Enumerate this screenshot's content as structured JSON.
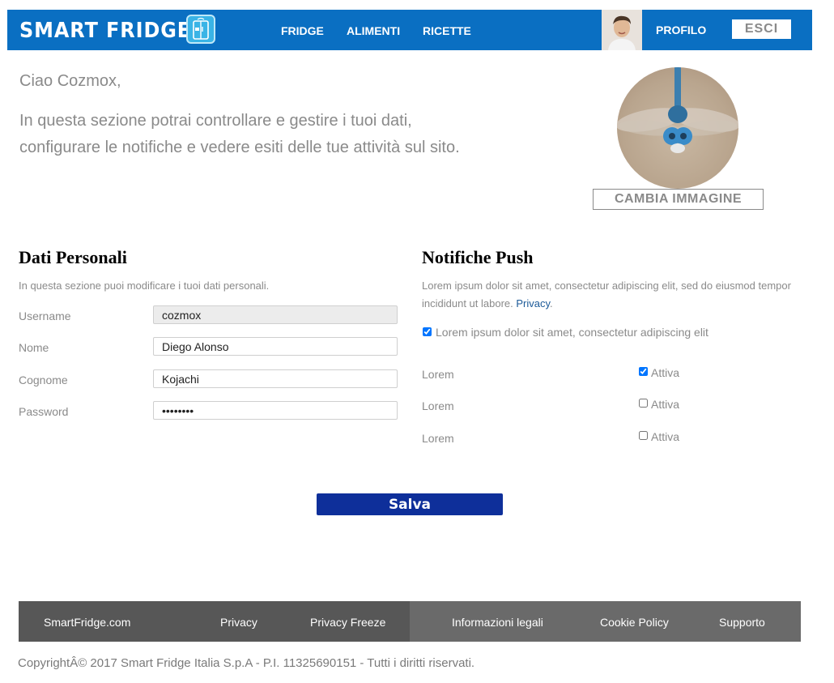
{
  "header": {
    "brand": "SMART FRIDGE",
    "nav": [
      "FRIDGE",
      "ALIMENTI",
      "RICETTE"
    ],
    "profile_link": "PROFILO",
    "logout_label": "ESCI"
  },
  "intro": {
    "greeting": "Ciao Cozmox,",
    "line1": "In questa sezione potrai controllare e gestire i tuoi dati,",
    "line2": "configurare le notifiche e vedere esiti delle tue attività sul sito.",
    "change_image_label": "CAMBIA IMMAGINE"
  },
  "personal": {
    "title": "Dati Personali",
    "description": "In questa sezione puoi modificare i tuoi dati personali.",
    "fields": [
      {
        "label": "Username",
        "value": "cozmox"
      },
      {
        "label": "Nome",
        "value": "Diego Alonso"
      },
      {
        "label": "Cognome",
        "value": "Kojachi"
      },
      {
        "label": "Password",
        "value": "••••••••"
      }
    ]
  },
  "notifications": {
    "title": "Notifiche Push",
    "description_prefix": "Lorem ipsum dolor sit amet, consectetur adipiscing elit, sed do eiusmod tempor incididunt ut labore.",
    "privacy_link": "Privacy",
    "description_suffix": ".",
    "agree_label": "Lorem ipsum dolor sit amet, consectetur adipiscing elit",
    "agree_checked": true,
    "items": [
      {
        "label": "Lorem",
        "toggle_label": "Attiva",
        "checked": true
      },
      {
        "label": "Lorem",
        "toggle_label": "Attiva",
        "checked": false
      },
      {
        "label": "Lorem",
        "toggle_label": "Attiva",
        "checked": false
      }
    ]
  },
  "save_label": "Salva",
  "footer": {
    "links_left": [
      "SmartFridge.com",
      "Privacy",
      "Privacy Freeze"
    ],
    "links_right": [
      "Informazioni legali",
      "Cookie Policy",
      "Supporto"
    ],
    "copyright": "CopyrightÂ© 2017 Smart Fridge Italia S.p.A - P.I. 11325690151 - Tutti i diritti riservati."
  },
  "colors": {
    "header_bg": "#0a6fc2",
    "save_bg": "#0e2f9a",
    "footer_left_bg": "#575757",
    "footer_right_bg": "#6a6a6a"
  }
}
